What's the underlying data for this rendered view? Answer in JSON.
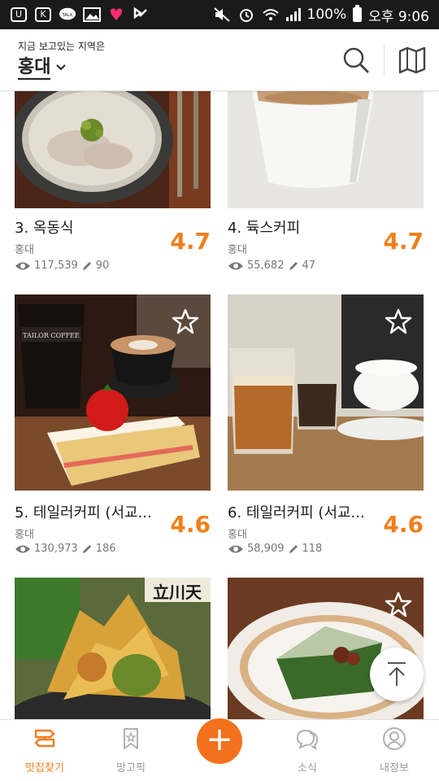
{
  "statusbar": {
    "notif_talk": "TALK",
    "battery": "100%",
    "time": "오후 9:06"
  },
  "header": {
    "subtitle": "지금 보고있는 지역은",
    "region": "홍대"
  },
  "cards": [
    {
      "rank_title": "3. 옥동식",
      "region": "홍대",
      "views": "117,539",
      "reviews": "90",
      "score": "4.7"
    },
    {
      "rank_title": "4. 듁스커피",
      "region": "홍대",
      "views": "55,682",
      "reviews": "47",
      "score": "4.7"
    },
    {
      "rank_title": "5. 테일러커피 (서교...",
      "region": "홍대",
      "views": "130,973",
      "reviews": "186",
      "score": "4.6",
      "sign_text": "TAILOR COFFEE"
    },
    {
      "rank_title": "6. 테일러커피 (서교...",
      "region": "홍대",
      "views": "58,909",
      "reviews": "118",
      "score": "4.6"
    },
    {
      "sign_text": "立川天"
    },
    {}
  ],
  "bottom_nav": [
    {
      "label": "맛집찾기",
      "active": true
    },
    {
      "label": "망고픽",
      "active": false
    },
    {
      "label": "+",
      "active": false
    },
    {
      "label": "소식",
      "active": false
    },
    {
      "label": "내정보",
      "active": false
    }
  ],
  "colors": {
    "accent": "#f07f1d",
    "fab": "#f2711c"
  }
}
